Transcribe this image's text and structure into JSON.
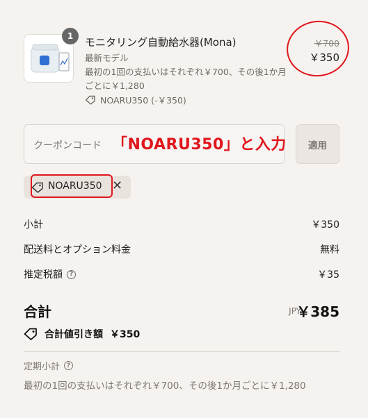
{
  "product": {
    "qty": "1",
    "title": "モニタリング自動給水器(Mona)",
    "variant": "最新モデル",
    "note": "最初の1回の支払いはそれぞれ￥700、その後1か月ごとに￥1,280",
    "discount_code": "NOARU350 (-￥350)",
    "original_price": "￥700",
    "price": "￥350"
  },
  "coupon": {
    "placeholder": "クーポンコード",
    "annotation": "「NOARU350」と入力",
    "apply_label": "適用",
    "applied_code": "NOARU350"
  },
  "summary": {
    "subtotal_label": "小計",
    "subtotal_value": "￥350",
    "shipping_label": "配送料とオプション料金",
    "shipping_value": "無料",
    "tax_label": "推定税額",
    "tax_value": "￥35",
    "total_label": "合計",
    "total_currency": "JPY",
    "total_value": "￥385",
    "savings_label": "合計値引き額",
    "savings_value": "￥350"
  },
  "subscription": {
    "label": "定期小計",
    "note": "最初の1回の支払いはそれぞれ￥700、その後1か月ごとに￥1,280"
  },
  "colors": {
    "background": "#f5f2ef",
    "annotation_red": "#e0161c",
    "muted_text": "#7d7873"
  }
}
